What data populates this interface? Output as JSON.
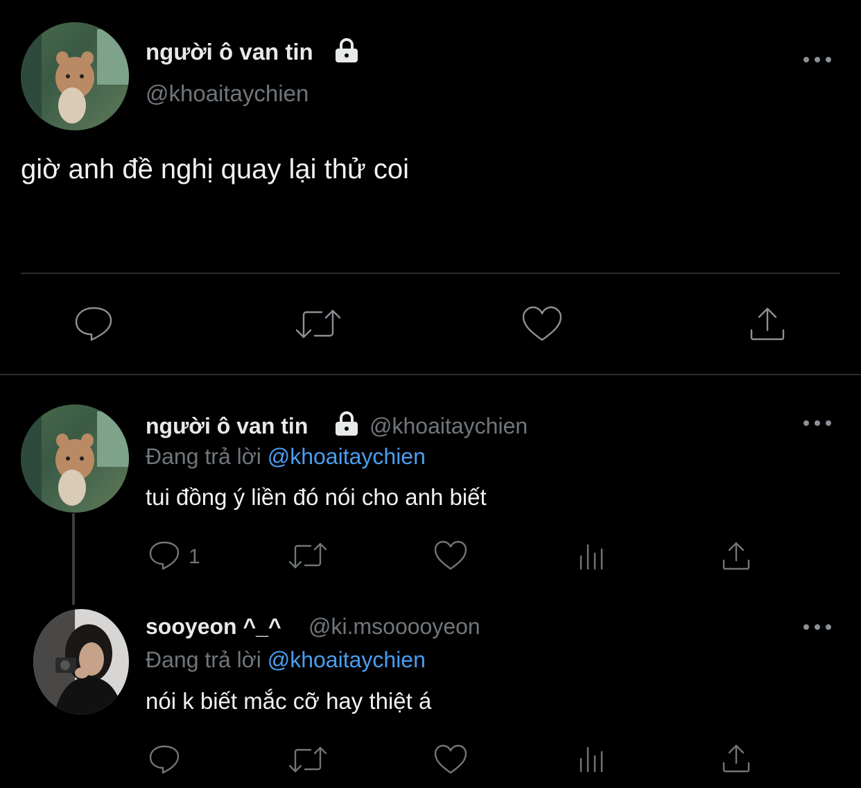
{
  "main_tweet": {
    "display_name": "người ô van tin",
    "handle": "@khoaitaychien",
    "text": "giờ anh đề nghị quay lại thử coi",
    "more_icon": "more-horizontal-icon",
    "actions": [
      "reply-icon",
      "retweet-icon",
      "like-icon",
      "share-icon"
    ]
  },
  "replies": [
    {
      "display_name": "người ô van tin",
      "handle": "@khoaitaychien",
      "replying_prefix": "Đang trả lời",
      "replying_to": "@khoaitaychien",
      "text": "tui đồng ý liền đó nói cho anh biết",
      "reply_count": "1",
      "actions": [
        "reply-icon",
        "retweet-icon",
        "like-icon",
        "analytics-icon",
        "share-icon"
      ]
    },
    {
      "display_name": "sooyeon ^_^",
      "handle": "@ki.msooooyeon",
      "replying_prefix": "Đang trả lời",
      "replying_to": "@khoaitaychien",
      "text": "nói k biết mắc cỡ hay thiệt á",
      "reply_count": "",
      "actions": [
        "reply-icon",
        "retweet-icon",
        "like-icon",
        "analytics-icon",
        "share-icon"
      ]
    }
  ],
  "colors": {
    "background": "#000000",
    "text": "#e7e9ea",
    "muted": "#71767b",
    "link": "#4a9ef0"
  }
}
